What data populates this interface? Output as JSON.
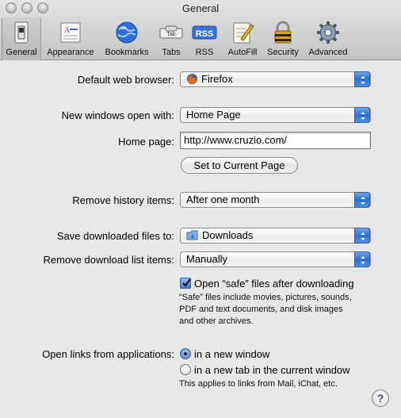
{
  "window": {
    "title": "General"
  },
  "toolbar": {
    "items": [
      {
        "label": "General",
        "icon": "switch-icon",
        "selected": true
      },
      {
        "label": "Appearance",
        "icon": "appearance-icon"
      },
      {
        "label": "Bookmarks",
        "icon": "globe-icon"
      },
      {
        "label": "Tabs",
        "icon": "tab-icon"
      },
      {
        "label": "RSS",
        "icon": "rss-icon",
        "badge": "RSS"
      },
      {
        "label": "AutoFill",
        "icon": "pencil-icon"
      },
      {
        "label": "Security",
        "icon": "lock-icon"
      },
      {
        "label": "Advanced",
        "icon": "gear-icon"
      }
    ],
    "tab_badge": "Tab"
  },
  "settings": {
    "default_browser": {
      "label": "Default web browser:",
      "value": "Firefox"
    },
    "new_windows": {
      "label": "New windows open with:",
      "value": "Home Page"
    },
    "home_page": {
      "label": "Home page:",
      "value": "http://www.cruzio.com/"
    },
    "set_current_page": {
      "label": "Set to Current Page"
    },
    "remove_history": {
      "label": "Remove history items:",
      "value": "After one month"
    },
    "save_downloads": {
      "label": "Save downloaded files to:",
      "value": "Downloads"
    },
    "remove_download_list": {
      "label": "Remove download list items:",
      "value": "Manually"
    },
    "open_safe": {
      "label": "Open “safe” files after downloading",
      "checked": true,
      "description_lines": [
        "“Safe” files include movies, pictures, sounds,",
        "PDF and text documents, and disk images",
        "and other archives."
      ]
    },
    "open_links": {
      "label": "Open links from applications:",
      "options": [
        {
          "label": "in a new window",
          "selected": true
        },
        {
          "label": "in a new tab in the current window",
          "selected": false
        }
      ],
      "note": "This applies to links from Mail, iChat, etc."
    },
    "help": "?"
  },
  "colors": {
    "accent": "#3e7bd6",
    "background": "#e8e8e8"
  }
}
